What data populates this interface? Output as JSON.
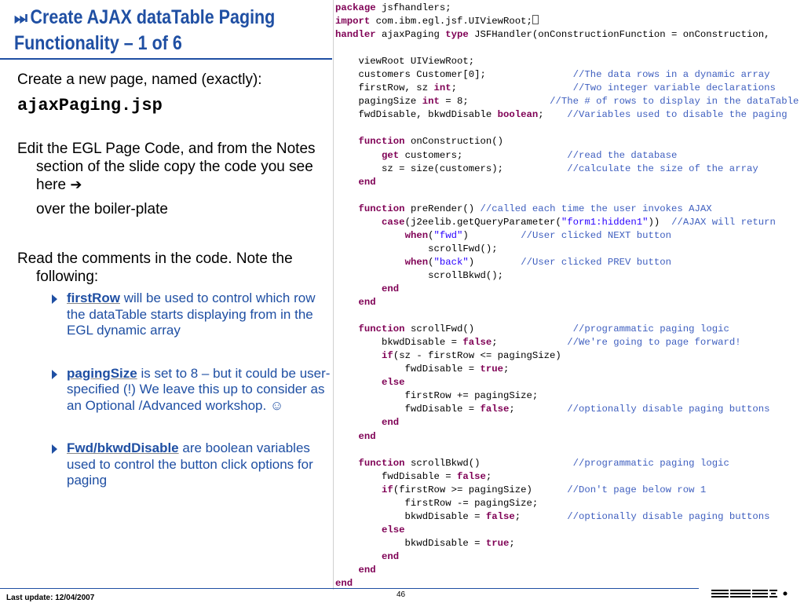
{
  "slide": {
    "title_line1": "Create AJAX dataTable Paging",
    "title_line2": "Functionality – 1 of 6",
    "title_icon": "⏭",
    "accent_color": "#1f4fa3"
  },
  "left": {
    "p1": "Create a new page, named (exactly):",
    "filename": "ajaxPaging.jsp",
    "p2": "Edit the EGL Page Code, and from the Notes section of the slide copy the code you see here",
    "p2_arrow": "➔",
    "p2_sub": "over the boiler-plate",
    "p3": "Read the comments in the code.  Note the following:",
    "bullets": [
      {
        "term": "firstRow",
        "text": " will be used to control which row the dataTable starts displaying from in the EGL dynamic array"
      },
      {
        "term": "pagingSize",
        "text": " is set to 8 – but it could be user-specified (!) We leave this up to consider as an Optional /Advanced workshop. ☺"
      },
      {
        "term": "Fwd/bkwdDisable",
        "text": " are boolean variables used to control the button click options for paging"
      }
    ]
  },
  "code": {
    "colors": {
      "keyword": "#7f0055",
      "comment": "#3f5fbf",
      "string": "#2a00ff"
    },
    "lines": [
      [
        [
          "kw",
          "package"
        ],
        [
          "t",
          " jsfhandlers;"
        ]
      ],
      [
        [
          "kw",
          "import"
        ],
        [
          "t",
          " com.ibm.egl.jsf.UIViewRoot;"
        ],
        [
          "box",
          ""
        ]
      ],
      [
        [
          "kw",
          "handler"
        ],
        [
          "t",
          " ajaxPaging "
        ],
        [
          "kw",
          "type"
        ],
        [
          "t",
          " JSFHandler(onConstructionFunction = onConstruction,"
        ]
      ],
      [
        [
          "t",
          ""
        ]
      ],
      [
        [
          "t",
          "    viewRoot UIViewRoot;"
        ]
      ],
      [
        [
          "t",
          "    customers Customer[0];               "
        ],
        [
          "cm",
          "//The data rows in a dynamic array"
        ]
      ],
      [
        [
          "t",
          "    firstRow, sz "
        ],
        [
          "kw",
          "int"
        ],
        [
          "t",
          ";                    "
        ],
        [
          "cm",
          "//Two integer variable declarations"
        ]
      ],
      [
        [
          "t",
          "    pagingSize "
        ],
        [
          "kw",
          "int"
        ],
        [
          "t",
          " = 8;              "
        ],
        [
          "cm",
          "//The # of rows to display in the dataTable"
        ]
      ],
      [
        [
          "t",
          "    fwdDisable, bkwdDisable "
        ],
        [
          "kw",
          "boolean"
        ],
        [
          "t",
          ";    "
        ],
        [
          "cm",
          "//Variables used to disable the paging"
        ]
      ],
      [
        [
          "t",
          ""
        ]
      ],
      [
        [
          "t",
          "    "
        ],
        [
          "kw",
          "function"
        ],
        [
          "t",
          " onConstruction()"
        ]
      ],
      [
        [
          "t",
          "        "
        ],
        [
          "kw",
          "get"
        ],
        [
          "t",
          " customers;                  "
        ],
        [
          "cm",
          "//read the database"
        ]
      ],
      [
        [
          "t",
          "        sz = size(customers);           "
        ],
        [
          "cm",
          "//calculate the size of the array"
        ]
      ],
      [
        [
          "t",
          "    "
        ],
        [
          "kw",
          "end"
        ]
      ],
      [
        [
          "t",
          ""
        ]
      ],
      [
        [
          "t",
          "    "
        ],
        [
          "kw",
          "function"
        ],
        [
          "t",
          " preRender() "
        ],
        [
          "cm",
          "//called each time the user invokes AJAX"
        ]
      ],
      [
        [
          "t",
          "        "
        ],
        [
          "kw",
          "case"
        ],
        [
          "t",
          "(j2eelib.getQueryParameter("
        ],
        [
          "st",
          "\"form1:hidden1\""
        ],
        [
          "t",
          "))  "
        ],
        [
          "cm",
          "//AJAX will return"
        ]
      ],
      [
        [
          "t",
          "            "
        ],
        [
          "kw",
          "when"
        ],
        [
          "t",
          "("
        ],
        [
          "st",
          "\"fwd\""
        ],
        [
          "t",
          ")         "
        ],
        [
          "cm",
          "//User clicked NEXT button"
        ]
      ],
      [
        [
          "t",
          "                scrollFwd();"
        ]
      ],
      [
        [
          "t",
          "            "
        ],
        [
          "kw",
          "when"
        ],
        [
          "t",
          "("
        ],
        [
          "st",
          "\"back\""
        ],
        [
          "t",
          ")        "
        ],
        [
          "cm",
          "//User clicked PREV button"
        ]
      ],
      [
        [
          "t",
          "                scrollBkwd();"
        ]
      ],
      [
        [
          "t",
          "        "
        ],
        [
          "kw",
          "end"
        ]
      ],
      [
        [
          "t",
          "    "
        ],
        [
          "kw",
          "end"
        ]
      ],
      [
        [
          "t",
          ""
        ]
      ],
      [
        [
          "t",
          "    "
        ],
        [
          "kw",
          "function"
        ],
        [
          "t",
          " scrollFwd()                 "
        ],
        [
          "cm",
          "//programmatic paging logic"
        ]
      ],
      [
        [
          "t",
          "        bkwdDisable = "
        ],
        [
          "kw",
          "false"
        ],
        [
          "t",
          ";            "
        ],
        [
          "cm",
          "//We're going to page forward!"
        ]
      ],
      [
        [
          "t",
          "        "
        ],
        [
          "kw",
          "if"
        ],
        [
          "t",
          "(sz - firstRow <= pagingSize)"
        ]
      ],
      [
        [
          "t",
          "            fwdDisable = "
        ],
        [
          "kw",
          "true"
        ],
        [
          "t",
          ";"
        ]
      ],
      [
        [
          "t",
          "        "
        ],
        [
          "kw",
          "else"
        ]
      ],
      [
        [
          "t",
          "            firstRow += pagingSize;"
        ]
      ],
      [
        [
          "t",
          "            fwdDisable = "
        ],
        [
          "kw",
          "false"
        ],
        [
          "t",
          ";         "
        ],
        [
          "cm",
          "//optionally disable paging buttons"
        ]
      ],
      [
        [
          "t",
          "        "
        ],
        [
          "kw",
          "end"
        ]
      ],
      [
        [
          "t",
          "    "
        ],
        [
          "kw",
          "end"
        ]
      ],
      [
        [
          "t",
          ""
        ]
      ],
      [
        [
          "t",
          "    "
        ],
        [
          "kw",
          "function"
        ],
        [
          "t",
          " scrollBkwd()                "
        ],
        [
          "cm",
          "//programmatic paging logic"
        ]
      ],
      [
        [
          "t",
          "        fwdDisable = "
        ],
        [
          "kw",
          "false"
        ],
        [
          "t",
          ";"
        ]
      ],
      [
        [
          "t",
          "        "
        ],
        [
          "kw",
          "if"
        ],
        [
          "t",
          "(firstRow >= pagingSize)      "
        ],
        [
          "cm",
          "//Don't page below row 1"
        ]
      ],
      [
        [
          "t",
          "            firstRow -= pagingSize;"
        ]
      ],
      [
        [
          "t",
          "            bkwdDisable = "
        ],
        [
          "kw",
          "false"
        ],
        [
          "t",
          ";        "
        ],
        [
          "cm",
          "//optionally disable paging buttons"
        ]
      ],
      [
        [
          "t",
          "        "
        ],
        [
          "kw",
          "else"
        ]
      ],
      [
        [
          "t",
          "            bkwdDisable = "
        ],
        [
          "kw",
          "true"
        ],
        [
          "t",
          ";"
        ]
      ],
      [
        [
          "t",
          "        "
        ],
        [
          "kw",
          "end"
        ]
      ],
      [
        [
          "t",
          "    "
        ],
        [
          "kw",
          "end"
        ]
      ],
      [
        [
          "kw",
          "end"
        ]
      ]
    ]
  },
  "footer": {
    "last_update": "Last update: 12/04/2007",
    "page_number": "46",
    "logo_name": "ibm-logo"
  }
}
